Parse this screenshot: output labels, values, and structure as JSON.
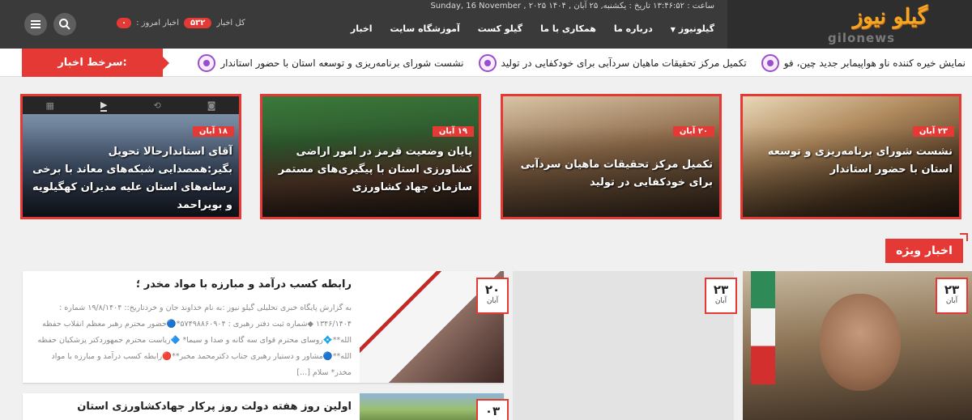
{
  "header": {
    "logo_fa": "گیلو نیوز",
    "logo_en": "gilonews",
    "dateline": "ساعت : ۱۳:۴۶:۵۲ تاریخ : یکشنبه, ۲۵ آبان , ۱۴۰۴ Sunday, 16 November , ۲۰۲۵",
    "nav": [
      {
        "label": "گیلونیوز"
      },
      {
        "label": "درباره ما"
      },
      {
        "label": "همکاری با ما"
      },
      {
        "label": "گیلو کست"
      },
      {
        "label": "آموزشگاه سایت"
      },
      {
        "label": "اخبار"
      }
    ],
    "total_news_label": "کل اخبار",
    "total_news_value": "۵۳۲",
    "today_news_label": "اخبار امروز :",
    "today_news_value": "۰"
  },
  "ticker": {
    "label": ":سرخط اخبار",
    "items": [
      {
        "text": "نشست شورای برنامه‌ریزی و توسعه استان با حضور استاندار"
      },
      {
        "text": "تکمیل مرکز تحقیقات ماهیان سردآبی برای خودکفایی در تولید"
      },
      {
        "text": "نمایش خیره کننده ناو هواپیمابر جدید چین، فو"
      }
    ]
  },
  "featured": [
    {
      "date": "۲۳ آبان",
      "title": "نشست شورای برنامه‌ریزی و توسعه استان با حضور استاندار"
    },
    {
      "date": "۲۰ آبان",
      "title": "تکمیل مرکز تحقیقات ماهیان سردآبی برای خودکفایی در تولید"
    },
    {
      "date": "۱۹ آبان",
      "title": "پایان وضعیت قرمز در امور اراضی کشاورزی استان با پیگیری‌های مستمر سازمان جهاد کشاورزی"
    },
    {
      "date": "۱۸ آبان",
      "title": "آقای استاندار‌حالا تحویل بگیر:همصدایی شبکه‌های معاند با برخی رسانه‌های استان علیه مدیران کهگیلویه و بویراحمد"
    }
  ],
  "special": {
    "title": "اخبار ویژه",
    "boxes": [
      {
        "day": "۲۳",
        "month": "آبان"
      },
      {
        "day": "۲۳",
        "month": "آبان"
      }
    ],
    "posts": [
      {
        "day": "۲۰",
        "month": "آبان",
        "title": "رابطه کسب درآمد و مبارزه با مواد مخدر ؛",
        "excerpt": "به گزارش پایگاه خبری تحلیلی گیلو نیوز :به نام خداوند جان و خردتاریخ:: ۱۹/۸/۱۴۰۴ شماره : ۱۳۴۶/۱۴۰۴ ◆شماره ثبت دفتر رهبری : ۵۷۴۹۸۸۶۰۹۰۴*🔵حضور محترم رهبر معظم انقلاب حفظه الله**💠روسای محترم قوای سه گانه و صدا و سیما* 🔷ریاست محترم جمهوردکتر پزشکیان حفظه الله**🔵مشاور و دستیار رهبری جناب دکترمحمد  مخبر**🔴رابطه کسب درآمد و مبارزه با مواد مخدر* سلام [...]"
      },
      {
        "day": "۰۳",
        "month": "",
        "title": "اولین روز هفته دولت روز پرکار جهادکشاورزی استان",
        "excerpt": ""
      }
    ]
  },
  "colors": {
    "accent": "#e53935",
    "topbar": "#3a3a3a",
    "logo": "#f5a623"
  }
}
